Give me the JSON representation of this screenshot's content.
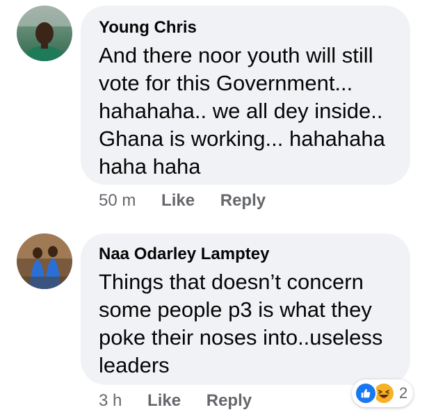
{
  "comments": [
    {
      "author": "Young Chris",
      "text": "And there noor youth will still\nvote for this Government...\nhahahaha.. we all dey inside..\nGhana is working... hahahaha\nhaha haha",
      "time": "50 m",
      "like_label": "Like",
      "reply_label": "Reply"
    },
    {
      "author": "Naa Odarley Lamptey",
      "text": "Things that doesn’t concern\nsome people p3 is what they\npoke their noses into..useless\nleaders",
      "time": "3 h",
      "like_label": "Like",
      "reply_label": "Reply",
      "reactions": {
        "icons": [
          "thumbs-up-icon",
          "laughing-face-icon"
        ],
        "count": "2"
      }
    }
  ],
  "colors": {
    "bubble": "#f0f2f5",
    "text": "#050505",
    "meta": "#65676b",
    "like_blue": "#1877f2",
    "haha_yellow": "#f7b125"
  }
}
